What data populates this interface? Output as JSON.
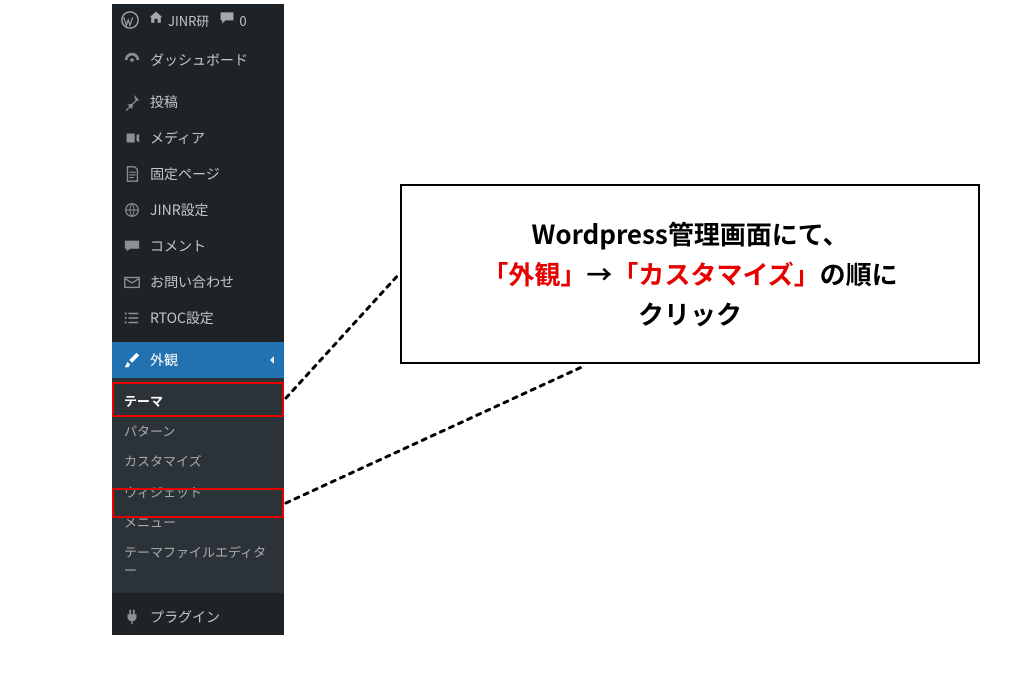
{
  "adminbar": {
    "site_name": "JINR研",
    "comment_count": "0"
  },
  "sidebar": {
    "dashboard": "ダッシュボード",
    "posts": "投稿",
    "media": "メディア",
    "pages": "固定ページ",
    "jinr": "JINR設定",
    "comments": "コメント",
    "contact": "お問い合わせ",
    "rtoc": "RTOC設定",
    "appearance": "外観",
    "plugins": "プラグイン"
  },
  "submenu": {
    "themes": "テーマ",
    "patterns": "パターン",
    "customize": "カスタマイズ",
    "widgets": "ウィジェット",
    "menu": "メニュー",
    "editor": "テーマファイルエディター"
  },
  "callout": {
    "line1": "Wordpress管理画面にて、",
    "line2_red1": "「外観」",
    "line2_arrow": "→",
    "line2_red2": "「カスタマイズ」",
    "line2_tail": "の順に",
    "line3": "クリック"
  }
}
